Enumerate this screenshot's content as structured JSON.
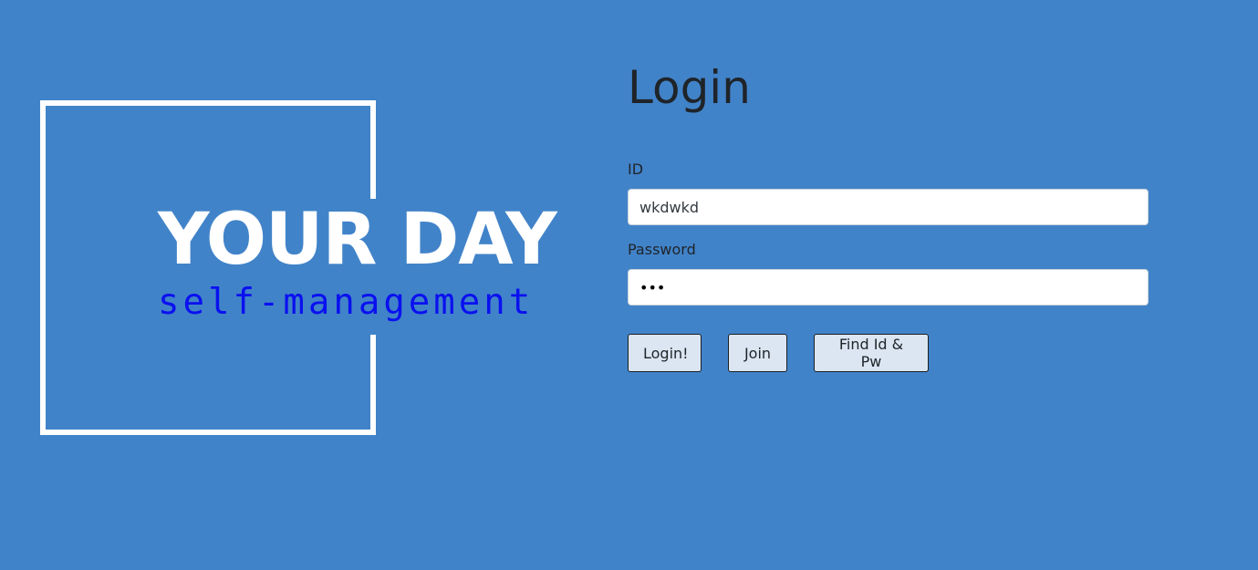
{
  "logo": {
    "title": "YOUR DAY",
    "subtitle": "self-management",
    "frame_color": "#ffffff",
    "subtitle_color": "#0a10f0"
  },
  "login": {
    "title": "Login",
    "id_label": "ID",
    "id_value": "wkdwkd",
    "password_label": "Password",
    "password_value": "123"
  },
  "buttons": {
    "login": "Login!",
    "join": "Join",
    "find": "Find Id & Pw"
  },
  "colors": {
    "background": "#4183c9",
    "button_bg": "#dbe6f2",
    "text": "#1f2429"
  }
}
